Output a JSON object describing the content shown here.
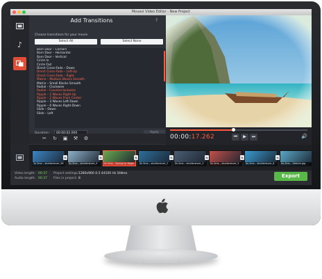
{
  "window": {
    "title": "Movavi Video Editor - New Project"
  },
  "sidebar": {
    "items": [
      {
        "name": "video-icon",
        "active": false
      },
      {
        "name": "music-icon",
        "active": false
      },
      {
        "name": "transitions-icon",
        "active": true
      }
    ]
  },
  "panel": {
    "title": "Add Transitions",
    "help": "?",
    "subtitle": "Choose transitions for your movie",
    "select_all": "Select All",
    "select_none": "Select None",
    "items": [
      {
        "label": "Barn Door – Corners",
        "highlight": false
      },
      {
        "label": "Barn Door – Horizontal",
        "highlight": false
      },
      {
        "label": "Barn Door – Vertical",
        "highlight": false
      },
      {
        "label": "Circle In",
        "highlight": false
      },
      {
        "label": "Circle Out",
        "highlight": false
      },
      {
        "label": "Direct Cross-Fade – Down",
        "highlight": false
      },
      {
        "label": "Direct Cross-Fade – Left-Up",
        "highlight": true
      },
      {
        "label": "Direct Cross-Fade – Right",
        "highlight": true
      },
      {
        "label": "Matrix – Medium Blocks Smooth",
        "highlight": true
      },
      {
        "label": "Matrix – Small Blocks Smooth",
        "highlight": false
      },
      {
        "label": "Radial – Clockwise",
        "highlight": false
      },
      {
        "label": "Radial – Counterclockwise",
        "highlight": true
      },
      {
        "label": "Ripple – 2 Waves Right-Up",
        "highlight": true
      },
      {
        "label": "Ripple – 2 Waves From Center",
        "highlight": true
      },
      {
        "label": "Ripple – 3 Waves Left-Down",
        "highlight": false
      },
      {
        "label": "Ripple – 6 Waves Right-Down",
        "highlight": false
      },
      {
        "label": "Slide – Down",
        "highlight": false
      },
      {
        "label": "Slide – Left",
        "highlight": false
      }
    ],
    "duration_label": "Duration:",
    "duration_value": "00:00:02.000",
    "apply": "Apply"
  },
  "toolbar": {
    "icons": [
      "scissors-icon",
      "rotate-icon",
      "delete-icon",
      "wrench-icon",
      "settings-icon"
    ]
  },
  "player": {
    "timecode_main": "00:00:",
    "timecode_frac": "17.262",
    "progress": 0.46,
    "buttons": {
      "prev": "⏮",
      "play": "▶",
      "next": "⏭"
    },
    "volume_icon": "🔊"
  },
  "timeline": {
    "clips": [
      {
        "name": "1x 0ms – shutterstock_96",
        "selected": false,
        "color": "#3b86c4"
      },
      {
        "name": "0x 0ms – shutterstock_9",
        "selected": false,
        "color": "#8fb2c9"
      },
      {
        "name": "0x 0ms – Spring by Roger",
        "selected": true,
        "color": "#6aa84f"
      },
      {
        "name": "0x 0ms – shutterstock_2",
        "selected": false,
        "color": "#2e6f9a"
      },
      {
        "name": "0x 0ms – shutterstock_3",
        "selected": false,
        "color": "#4b5e73"
      },
      {
        "name": "0x 0ms – shutterstock_5",
        "selected": false,
        "color": "#c2504a"
      },
      {
        "name": "0x 0ms – shutterstock_8",
        "selected": false,
        "color": "#3a9ad0"
      },
      {
        "name": "0x 0ms – Vilamin.jpg",
        "selected": false,
        "color": "#5aa7c7"
      }
    ]
  },
  "status": {
    "video_length_label": "Video length:",
    "video_length": "00:37",
    "audio_length_label": "Audio length:",
    "audio_length": "00:37",
    "project_settings_label": "Project settings:",
    "project_settings": "1280x960 4:3 44100 Hz Stereo",
    "files_label": "Files in project:",
    "files": "8",
    "export": "Export"
  }
}
